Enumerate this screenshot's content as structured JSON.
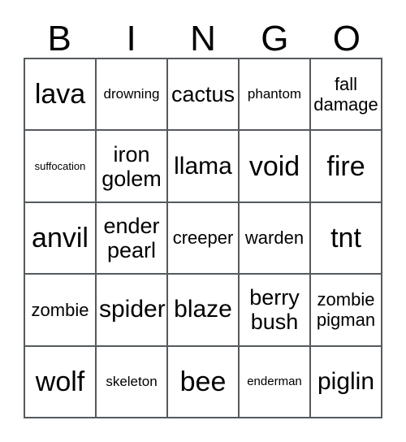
{
  "card": {
    "title": "BINGO",
    "header_letters": [
      "B",
      "I",
      "N",
      "G",
      "O"
    ],
    "columns": 5,
    "rows": 5,
    "colors": {
      "background": "#ffffff",
      "grid_line": "#555a5e",
      "text": "#000000"
    },
    "cells": [
      {
        "text": "lava",
        "size": "sz-xxl"
      },
      {
        "text": "drowning",
        "size": "sz-s"
      },
      {
        "text": "cactus",
        "size": "sz-l"
      },
      {
        "text": "phantom",
        "size": "sz-s"
      },
      {
        "text": "fall\ndamage",
        "size": "sz-m"
      },
      {
        "text": "suffocation",
        "size": "sz-xxs"
      },
      {
        "text": "iron\ngolem",
        "size": "sz-l"
      },
      {
        "text": "llama",
        "size": "sz-xl"
      },
      {
        "text": "void",
        "size": "sz-xxl"
      },
      {
        "text": "fire",
        "size": "sz-xxl"
      },
      {
        "text": "anvil",
        "size": "sz-xxl"
      },
      {
        "text": "ender\npearl",
        "size": "sz-l"
      },
      {
        "text": "creeper",
        "size": "sz-m"
      },
      {
        "text": "warden",
        "size": "sz-m"
      },
      {
        "text": "tnt",
        "size": "sz-xxl"
      },
      {
        "text": "zombie",
        "size": "sz-m"
      },
      {
        "text": "spider",
        "size": "sz-xl"
      },
      {
        "text": "blaze",
        "size": "sz-xl"
      },
      {
        "text": "berry\nbush",
        "size": "sz-l"
      },
      {
        "text": "zombie\npigman",
        "size": "sz-m"
      },
      {
        "text": "wolf",
        "size": "sz-xxl"
      },
      {
        "text": "skeleton",
        "size": "sz-s"
      },
      {
        "text": "bee",
        "size": "sz-xxl"
      },
      {
        "text": "enderman",
        "size": "sz-xs"
      },
      {
        "text": "piglin",
        "size": "sz-xl"
      }
    ]
  }
}
